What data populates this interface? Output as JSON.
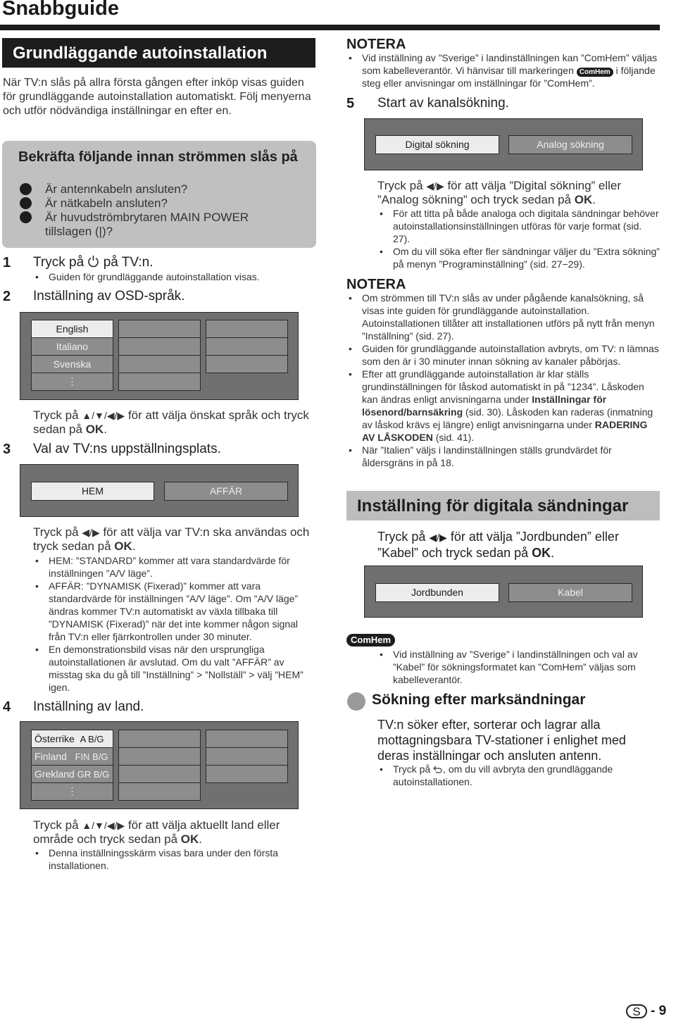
{
  "page": {
    "title": "Snabbguide",
    "page_letter": "S",
    "page_number": "- 9"
  },
  "left": {
    "section_title": "Grundläggande autoinstallation",
    "intro": "När TV:n slås på allra första gången efter inköp visas guiden för grundläggande autoinstallation automatiskt. Följ menyerna och utför nödvändiga inställningar en efter en.",
    "checklist": {
      "heading": "Bekräfta följande innan strömmen slås på",
      "items": [
        "Är antennkabeln ansluten?",
        "Är nätkabeln ansluten?",
        "Är huvudströmbrytaren MAIN POWER tillslagen (|)?"
      ]
    },
    "step1": {
      "num": "1",
      "text_before": "Tryck på",
      "icon": "power-icon",
      "text_after": "på TV:n.",
      "bullets": [
        "Guiden för grundläggande autoinstallation visas."
      ]
    },
    "step2": {
      "num": "2",
      "text": "Inställning av OSD-språk.",
      "menu": {
        "col1": [
          "English",
          "Italiano",
          "Svenska",
          "⋮"
        ],
        "selected": "English"
      },
      "instruction_before": "Tryck på",
      "arrows": "▲/▼/◀/▶",
      "instruction_after": "för att välja önskat språk och tryck sedan på",
      "ok": "OK",
      "period": "."
    },
    "step3": {
      "num": "3",
      "text": "Val av TV:ns uppställningsplats.",
      "options": [
        "HEM",
        "AFFÄR"
      ],
      "selected": "HEM",
      "instruction_before": "Tryck på",
      "arrows": "◀/▶",
      "instruction_after": "för att välja var TV:n ska användas och tryck sedan på",
      "ok": "OK",
      "period": ".",
      "bullets": [
        "HEM: ”STANDARD” kommer att vara standardvärde för inställningen ”A/V läge”.",
        "AFFÄR: ”DYNAMISK (Fixerad)” kommer att vara standardvärde för inställningen ”A/V läge”. Om ”A/V läge” ändras kommer TV:n automatiskt av växla tillbaka till ”DYNAMISK (Fixerad)” när det inte kommer någon signal från TV:n eller fjärrkontrollen under 30 minuter.",
        "En demonstrationsbild visas när den ursprungliga autoinstallationen är avslutad. Om du valt ”AFFÄR” av misstag ska du gå till ”Inställning” > ”Nollställ” > välj ”HEM” igen."
      ]
    },
    "step4": {
      "num": "4",
      "text": "Inställning av land.",
      "menu": {
        "col1": [
          {
            "name": "Österrike",
            "code": "A  B/G"
          },
          {
            "name": "Finland",
            "code": "FIN B/G"
          },
          {
            "name": "Grekland",
            "code": "GR B/G"
          },
          {
            "name": "⋮",
            "code": ""
          }
        ],
        "selected": "Österrike"
      },
      "instruction_before": "Tryck på",
      "arrows": "▲/▼/◀/▶",
      "instruction_after": "för att välja aktuellt land eller område och tryck sedan på",
      "ok": "OK",
      "period": ".",
      "bullets": [
        "Denna inställningsskärm visas bara under den första installationen."
      ]
    }
  },
  "right": {
    "note1": {
      "heading": "NOTERA",
      "text_before": "Vid inställning av ”Sverige” i landinställningen kan ”ComHem” väljas som kabelleverantör. Vi hänvisar till markeringen",
      "badge": "ComHem",
      "text_after": "i följande steg eller anvisningar om inställningar för ”ComHem”."
    },
    "step5": {
      "num": "5",
      "text": "Start av kanalsökning.",
      "options": [
        "Digital sökning",
        "Analog sökning"
      ],
      "selected": "Digital sökning",
      "instruction_before": "Tryck på",
      "arrows": "◀/▶",
      "instruction_after": "för att välja ”Digital sökning” eller ”Analog sökning” och tryck sedan på",
      "ok": "OK",
      "period": ".",
      "bullets": [
        "För att titta på både analoga och digitala sändningar behöver autoinstallationsinställningen utföras för varje format (sid. 27).",
        "Om du vill söka efter fler sändningar väljer du ”Extra sökning” på menyn ”Programinställning” (sid. 27−29)."
      ]
    },
    "note2": {
      "heading": "NOTERA",
      "b1": "Om strömmen till TV:n slås av under pågående kanalsökning, så visas inte guiden för grundläggande autoinstallation. Autoinstallationen tillåter att installationen utförs på nytt från menyn ”Inställning” (sid. 27).",
      "b2": "Guiden för grundläggande autoinstallation avbryts, om TV: n lämnas som den är i 30 minuter innan sökning av kanaler påbörjas.",
      "b3_part1": "Efter att grundläggande autoinstallation är klar ställs grundinställningen för låskod automatiskt in på ”1234”. Låskoden kan ändras enligt anvisningarna under",
      "b3_bold1": "Inställningar för lösenord/barnsäkring",
      "b3_part2": "(sid. 30). Låskoden kan raderas (inmatning av låskod krävs ej längre) enligt anvisningarna under",
      "b3_bold2": "RADERING AV LÅSKODEN",
      "b3_part3": "(sid. 41).",
      "b4": "När ”Italien” väljs i landinställningen ställs grundvärdet för åldersgräns in på 18."
    },
    "digital": {
      "section_title": "Inställning för digitala sändningar",
      "instruction_before": "Tryck på",
      "arrows": "◀/▶",
      "instruction_after": "för att välja ”Jordbunden” eller ”Kabel” och tryck sedan på",
      "ok": "OK",
      "period": ".",
      "options": [
        "Jordbunden",
        "Kabel"
      ],
      "selected": "Jordbunden"
    },
    "comhem": {
      "badge": "ComHem",
      "bullets": [
        "Vid inställning av ”Sverige” i landinställningen och val av ”Kabel” för sökningsformatet kan ”ComHem” väljas som kabelleverantör."
      ]
    },
    "terrestrial": {
      "heading": "Sökning efter marksändningar",
      "text": "TV:n söker efter, sorterar och lagrar alla mottagningsbara TV-stationer i enlighet med deras inställningar och ansluten antenn.",
      "bullet_before": "Tryck på",
      "bullet_icon": "return-icon",
      "bullet_after": ", om du vill avbryta den grundläggande autoinstallationen."
    }
  }
}
